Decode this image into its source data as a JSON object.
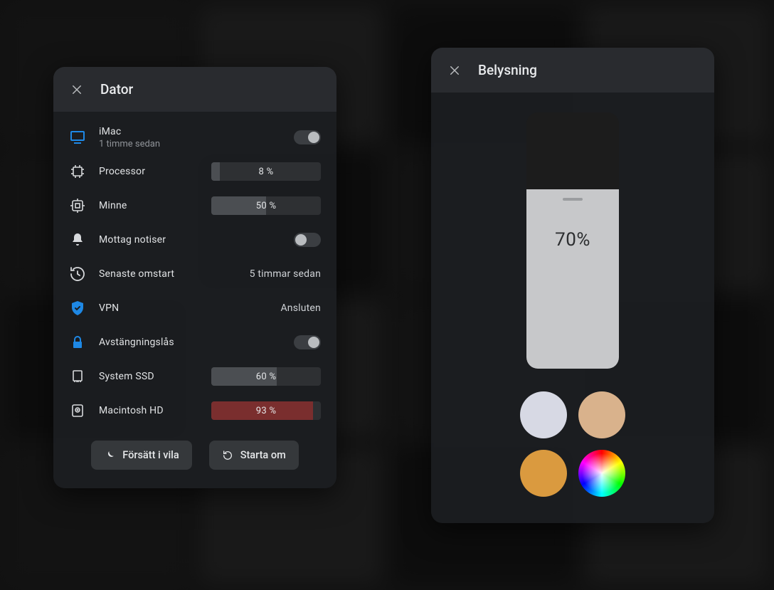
{
  "dator": {
    "title": "Dator",
    "device": {
      "name": "iMac",
      "subtitle": "1 timme sedan",
      "toggle_on": true
    },
    "processor": {
      "label": "Processor",
      "percent": 8,
      "text": "8 %"
    },
    "memory": {
      "label": "Minne",
      "percent": 50,
      "text": "50 %"
    },
    "notify": {
      "label": "Mottag notiser",
      "toggle_on": false
    },
    "restart": {
      "label": "Senaste omstart",
      "value": "5 timmar sedan"
    },
    "vpn": {
      "label": "VPN",
      "value": "Ansluten"
    },
    "lock": {
      "label": "Avstängningslås",
      "toggle_on": true
    },
    "ssd": {
      "label": "System SSD",
      "percent": 60,
      "text": "60 %"
    },
    "hdd": {
      "label": "Macintosh HD",
      "percent": 93,
      "text": "93 %"
    },
    "actions": {
      "sleep": "Försätt i vila",
      "restart": "Starta om"
    }
  },
  "belysning": {
    "title": "Belysning",
    "level_percent": 70,
    "level_text": "70%",
    "swatches": {
      "a": "#d7d9e4",
      "b": "#d9b28c",
      "c": "#da9a3f"
    }
  }
}
